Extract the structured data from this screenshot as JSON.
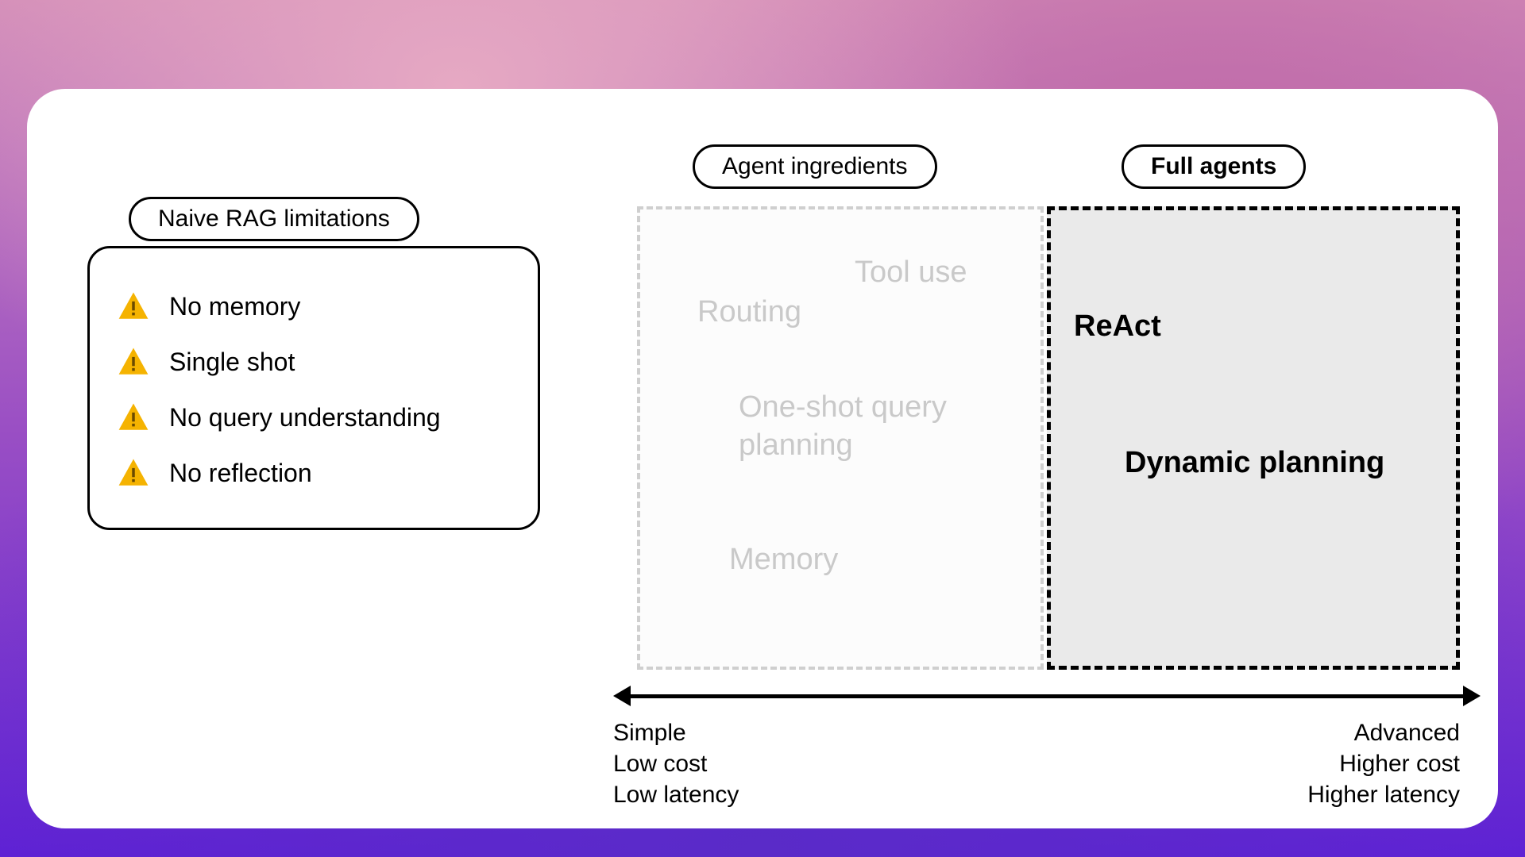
{
  "left": {
    "pill": "Naive RAG limitations",
    "items": [
      "No memory",
      "Single shot",
      "No query understanding",
      "No reflection"
    ]
  },
  "center": {
    "pill": "Agent ingredients",
    "tool_use": "Tool use",
    "routing": "Routing",
    "one_shot_l1": "One-shot query",
    "one_shot_l2": "planning",
    "memory": "Memory"
  },
  "right": {
    "pill": "Full agents",
    "react": "ReAct",
    "dynamic": "Dynamic planning"
  },
  "axis": {
    "left_l1": "Simple",
    "left_l2": "Low cost",
    "left_l3": "Low latency",
    "right_l1": "Advanced",
    "right_l2": "Higher cost",
    "right_l3": "Higher latency"
  }
}
